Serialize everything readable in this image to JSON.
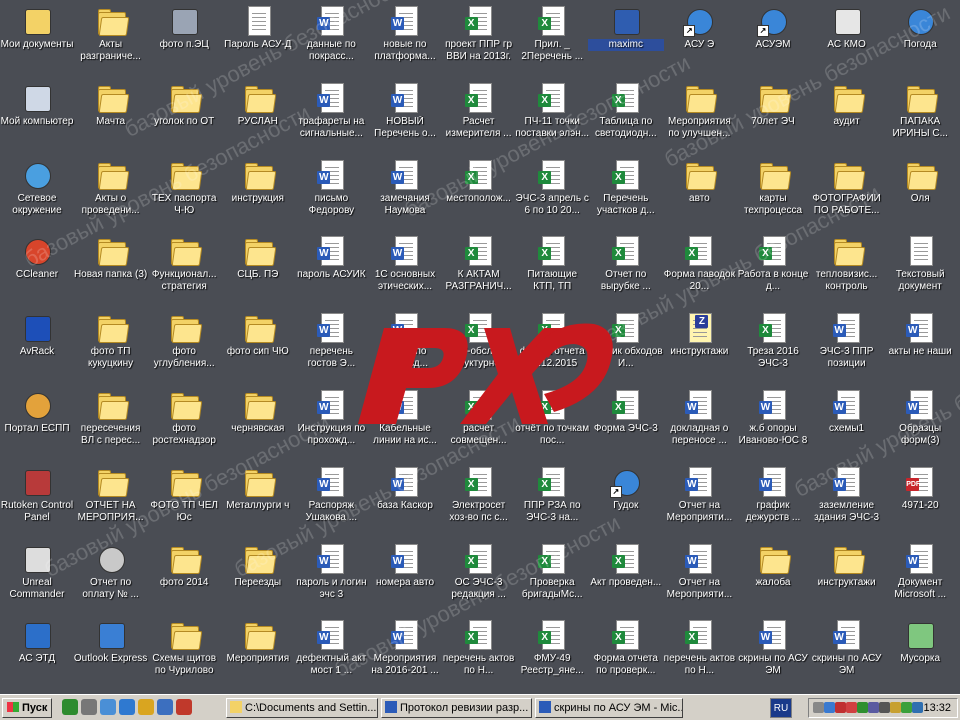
{
  "desktop": {
    "icons": [
      {
        "label": "Мои документы",
        "type": "mydocs",
        "col": 0,
        "row": 0
      },
      {
        "label": "Акты разграниче...",
        "type": "folder",
        "col": 1,
        "row": 0
      },
      {
        "label": "фото п.ЭЦ",
        "type": "camera",
        "col": 2,
        "row": 0
      },
      {
        "label": "Пароль АСУ-Д",
        "type": "txt",
        "col": 3,
        "row": 0
      },
      {
        "label": "данные по покрасс...",
        "type": "word",
        "col": 4,
        "row": 0
      },
      {
        "label": "новые по платформа...",
        "type": "word",
        "col": 5,
        "row": 0
      },
      {
        "label": "проект ППР гр ВВИ на 2013г.",
        "type": "excel",
        "col": 6,
        "row": 0
      },
      {
        "label": "Прил. _ 2Перечень ...",
        "type": "excel",
        "col": 7,
        "row": 0
      },
      {
        "label": "maximc",
        "type": "app-blue",
        "col": 8,
        "row": 0,
        "selected": true
      },
      {
        "label": "АСУ Э",
        "type": "ie",
        "col": 9,
        "row": 0,
        "shortcut": true
      },
      {
        "label": "АСУЭМ",
        "type": "ie",
        "col": 10,
        "row": 0,
        "shortcut": true
      },
      {
        "label": "АС КМО",
        "type": "app-color",
        "col": 11,
        "row": 0
      },
      {
        "label": "Погода",
        "type": "ie",
        "col": 12,
        "row": 0
      },
      {
        "label": "Мой компьютер",
        "type": "computer",
        "col": 0,
        "row": 1
      },
      {
        "label": "Мачта",
        "type": "folder",
        "col": 1,
        "row": 1
      },
      {
        "label": "уголок по ОТ",
        "type": "folder",
        "col": 2,
        "row": 1
      },
      {
        "label": "РУСЛАН",
        "type": "folder",
        "col": 3,
        "row": 1
      },
      {
        "label": "трафареты на сигнальные...",
        "type": "word",
        "col": 4,
        "row": 1
      },
      {
        "label": "НОВЫЙ Перечень о...",
        "type": "word",
        "col": 5,
        "row": 1
      },
      {
        "label": "Расчет измерителя ...",
        "type": "excel",
        "col": 6,
        "row": 1
      },
      {
        "label": "ПЧ-11 точки поставки элэн...",
        "type": "excel",
        "col": 7,
        "row": 1
      },
      {
        "label": "Таблица по светодиодн...",
        "type": "excel",
        "col": 8,
        "row": 1
      },
      {
        "label": "Мероприятия по улучшен...",
        "type": "folder",
        "col": 9,
        "row": 1
      },
      {
        "label": "70лет ЭЧ",
        "type": "folder",
        "col": 10,
        "row": 1
      },
      {
        "label": "аудит",
        "type": "folder",
        "col": 11,
        "row": 1
      },
      {
        "label": "ПАПАКА ИРИНЫ С...",
        "type": "folder",
        "col": 12,
        "row": 1
      },
      {
        "label": "Сетевое окружение",
        "type": "network",
        "col": 0,
        "row": 2
      },
      {
        "label": "Акты о проведени...",
        "type": "folder",
        "col": 1,
        "row": 2
      },
      {
        "label": "ТЕХ паспорта Ч-Ю",
        "type": "folder",
        "col": 2,
        "row": 2
      },
      {
        "label": "инструкция",
        "type": "folder",
        "col": 3,
        "row": 2
      },
      {
        "label": "письмо Федорову",
        "type": "word",
        "col": 4,
        "row": 2
      },
      {
        "label": "замечания Наумова",
        "type": "word",
        "col": 5,
        "row": 2
      },
      {
        "label": "местополож...",
        "type": "excel",
        "col": 6,
        "row": 2
      },
      {
        "label": "ЭЧС-3 апрель с 6 по 10 20...",
        "type": "excel",
        "col": 7,
        "row": 2
      },
      {
        "label": "Перечень участков д...",
        "type": "excel",
        "col": 8,
        "row": 2
      },
      {
        "label": "авто",
        "type": "folder",
        "col": 9,
        "row": 2
      },
      {
        "label": "карты техпроцесса",
        "type": "folder",
        "col": 10,
        "row": 2
      },
      {
        "label": "ФОТОГРАФИИ ПО РАБОТЕ...",
        "type": "folder",
        "col": 11,
        "row": 2
      },
      {
        "label": "Оля",
        "type": "folder",
        "col": 12,
        "row": 2
      },
      {
        "label": "CCleaner",
        "type": "ccleaner",
        "col": 0,
        "row": 3
      },
      {
        "label": "Новая папка (3)",
        "type": "folder",
        "col": 1,
        "row": 3
      },
      {
        "label": "Функционал... стратегия",
        "type": "folder",
        "col": 2,
        "row": 3
      },
      {
        "label": "СЦБ. ПЭ",
        "type": "folder",
        "col": 3,
        "row": 3
      },
      {
        "label": "пароль АСУИК",
        "type": "word",
        "col": 4,
        "row": 3
      },
      {
        "label": "1С основных этических...",
        "type": "word",
        "col": 5,
        "row": 3
      },
      {
        "label": "К АКТАМ РАЗГРАНИЧ...",
        "type": "excel",
        "col": 6,
        "row": 3
      },
      {
        "label": "Питающие КТП, ТП",
        "type": "excel",
        "col": 7,
        "row": 3
      },
      {
        "label": "Отчет по вырубке ...",
        "type": "excel",
        "col": 8,
        "row": 3
      },
      {
        "label": "Форма паводок 20...",
        "type": "excel",
        "col": 9,
        "row": 3
      },
      {
        "label": "Работа в конце д...",
        "type": "excel",
        "col": 10,
        "row": 3
      },
      {
        "label": "тепловизис... контроль",
        "type": "folder",
        "col": 11,
        "row": 3
      },
      {
        "label": "Текстовый документ",
        "type": "txt",
        "col": 12,
        "row": 3
      },
      {
        "label": "AvRack",
        "type": "app-blue2",
        "col": 0,
        "row": 4
      },
      {
        "label": "фото ТП кукуцкину",
        "type": "folder",
        "col": 1,
        "row": 4
      },
      {
        "label": "фото углубления...",
        "type": "folder",
        "col": 2,
        "row": 4
      },
      {
        "label": "фото сип ЧЮ",
        "type": "folder",
        "col": 3,
        "row": 4
      },
      {
        "label": "перечень гостов Э...",
        "type": "word",
        "col": 4,
        "row": 4
      },
      {
        "label": "новые по переезд...",
        "type": "word",
        "col": 5,
        "row": 4
      },
      {
        "label": "пп17-обслед... структурно...",
        "type": "excel",
        "col": 6,
        "row": 4
      },
      {
        "label": "форма отчета 24.12.2015",
        "type": "excel",
        "col": 7,
        "row": 4
      },
      {
        "label": "график обходов И...",
        "type": "excel",
        "col": 8,
        "row": 4
      },
      {
        "label": "инструктажи",
        "type": "zip",
        "col": 9,
        "row": 4
      },
      {
        "label": "Треза 2016 ЭЧС-3",
        "type": "excel",
        "col": 10,
        "row": 4
      },
      {
        "label": "ЭЧС-3 ППР позиции",
        "type": "word",
        "col": 11,
        "row": 4
      },
      {
        "label": "акты не наши",
        "type": "word",
        "col": 12,
        "row": 4
      },
      {
        "label": "Портал ЕСПП",
        "type": "people",
        "col": 0,
        "row": 5
      },
      {
        "label": "пересечения ВЛ с перес...",
        "type": "folder",
        "col": 1,
        "row": 5
      },
      {
        "label": "фото ростехнадзор",
        "type": "folder",
        "col": 2,
        "row": 5
      },
      {
        "label": "чернявская",
        "type": "folder",
        "col": 3,
        "row": 5
      },
      {
        "label": "Инструкция по прохожд...",
        "type": "word",
        "col": 4,
        "row": 5
      },
      {
        "label": "Кабельные линии на ис...",
        "type": "word",
        "col": 5,
        "row": 5
      },
      {
        "label": "расчет совмещен...",
        "type": "excel",
        "col": 6,
        "row": 5
      },
      {
        "label": "отчёт по точкам пос...",
        "type": "excel",
        "col": 7,
        "row": 5
      },
      {
        "label": "Форма ЭЧС-3",
        "type": "excel",
        "col": 8,
        "row": 5
      },
      {
        "label": "докладная о переносе ...",
        "type": "word",
        "col": 9,
        "row": 5
      },
      {
        "label": "ж.б опоры Иваново-ЮС 8",
        "type": "word",
        "col": 10,
        "row": 5
      },
      {
        "label": "схемы1",
        "type": "word",
        "col": 11,
        "row": 5
      },
      {
        "label": "Образцы форм(3)",
        "type": "word",
        "col": 12,
        "row": 5
      },
      {
        "label": "Rutoken Control Panel",
        "type": "tools",
        "col": 0,
        "row": 6
      },
      {
        "label": "ОТЧЕТ НА МЕРОПРИЯ...",
        "type": "folder",
        "col": 1,
        "row": 6
      },
      {
        "label": "ФОТО ТП ЧЕЛ Юс",
        "type": "folder",
        "col": 2,
        "row": 6
      },
      {
        "label": "Металлурги ч",
        "type": "folder",
        "col": 3,
        "row": 6
      },
      {
        "label": "Распоряж Ушакова ...",
        "type": "word",
        "col": 4,
        "row": 6
      },
      {
        "label": "база Каскор",
        "type": "word",
        "col": 5,
        "row": 6
      },
      {
        "label": "Электросет хоз-во пс с...",
        "type": "excel",
        "col": 6,
        "row": 6
      },
      {
        "label": "ППР РЗА по ЭЧС-3 на...",
        "type": "excel",
        "col": 7,
        "row": 6
      },
      {
        "label": "Гудок",
        "type": "ie",
        "col": 8,
        "row": 6,
        "shortcut": true
      },
      {
        "label": "Отчет на Мероприяти...",
        "type": "word",
        "col": 9,
        "row": 6
      },
      {
        "label": "график дежурств ...",
        "type": "word",
        "col": 10,
        "row": 6
      },
      {
        "label": "заземление здания ЭЧС-3",
        "type": "word",
        "col": 11,
        "row": 6
      },
      {
        "label": "4971-20",
        "type": "pdf",
        "col": 12,
        "row": 6
      },
      {
        "label": "Unreal Commander",
        "type": "unreal",
        "col": 0,
        "row": 7
      },
      {
        "label": "Отчет по оплату № ...",
        "type": "pdfcd",
        "col": 1,
        "row": 7
      },
      {
        "label": "фото 2014",
        "type": "folder",
        "col": 2,
        "row": 7
      },
      {
        "label": "Переезды",
        "type": "folder",
        "col": 3,
        "row": 7
      },
      {
        "label": "пароль и логин эчс 3",
        "type": "word",
        "col": 4,
        "row": 7
      },
      {
        "label": "номера авто",
        "type": "word",
        "col": 5,
        "row": 7
      },
      {
        "label": "ОС ЭЧС-3 редакция ...",
        "type": "excel",
        "col": 6,
        "row": 7
      },
      {
        "label": "Проверка бригадыМс...",
        "type": "excel",
        "col": 7,
        "row": 7
      },
      {
        "label": "Акт проведен...",
        "type": "excel",
        "col": 8,
        "row": 7
      },
      {
        "label": "Отчет на Мероприяти...",
        "type": "word",
        "col": 9,
        "row": 7
      },
      {
        "label": "жалоба",
        "type": "folder",
        "col": 10,
        "row": 7
      },
      {
        "label": "инструктажи",
        "type": "folder",
        "col": 11,
        "row": 7
      },
      {
        "label": "Документ Microsoft ...",
        "type": "word",
        "col": 12,
        "row": 7
      },
      {
        "label": "АС ЭТД",
        "type": "app-etd",
        "col": 0,
        "row": 8
      },
      {
        "label": "Outlook Express",
        "type": "outlook",
        "col": 1,
        "row": 8
      },
      {
        "label": "Схемы щитов по Чурилово",
        "type": "folder",
        "col": 2,
        "row": 8
      },
      {
        "label": "Мероприятия",
        "type": "folder",
        "col": 3,
        "row": 8
      },
      {
        "label": "дефектный акт мост 1 ...",
        "type": "word",
        "col": 4,
        "row": 8
      },
      {
        "label": "Мероприятия на 2016-201 ...",
        "type": "word",
        "col": 5,
        "row": 8
      },
      {
        "label": "перечень актов по Н...",
        "type": "excel",
        "col": 6,
        "row": 8
      },
      {
        "label": "ФМУ-49 Реестр_яне...",
        "type": "excel",
        "col": 7,
        "row": 8
      },
      {
        "label": "Форма отчета по проверк...",
        "type": "excel",
        "col": 8,
        "row": 8
      },
      {
        "label": "перечень актов по Н...",
        "type": "excel",
        "col": 9,
        "row": 8
      },
      {
        "label": "скрины по АСУ ЭМ",
        "type": "word",
        "col": 10,
        "row": 8
      },
      {
        "label": "скрины по АСУ ЭМ",
        "type": "word",
        "col": 11,
        "row": 8
      },
      {
        "label": "Мусорка",
        "type": "recycle",
        "col": 12,
        "row": 8
      }
    ],
    "logo": {
      "text": "РЖД",
      "color": "#c8191e"
    },
    "watermark": {
      "text": "базовый уровень безопасности"
    }
  },
  "taskbar": {
    "start_label": "Пуск",
    "quick_launch": [
      "tree-icon",
      "mouse-icon",
      "network-icon",
      "ie-icon",
      "outlook-icon",
      "desktop-icon",
      "media-icon"
    ],
    "tasks": [
      {
        "label": "C:\\Documents and Settin...",
        "icon": "folder-icon"
      },
      {
        "label": "Протокол ревизии разр...",
        "icon": "word-icon"
      },
      {
        "label": "скрины по АСУ ЭМ - Mic...",
        "icon": "word-icon"
      }
    ],
    "language": "RU",
    "clock": "13:32",
    "tray_icons": [
      "speaker-icon",
      "network-tray-icon",
      "shield-icon",
      "antivirus-icon",
      "update-icon",
      "display-icon",
      "printer-icon",
      "power-icon",
      "messenger-icon",
      "sync-icon"
    ]
  }
}
